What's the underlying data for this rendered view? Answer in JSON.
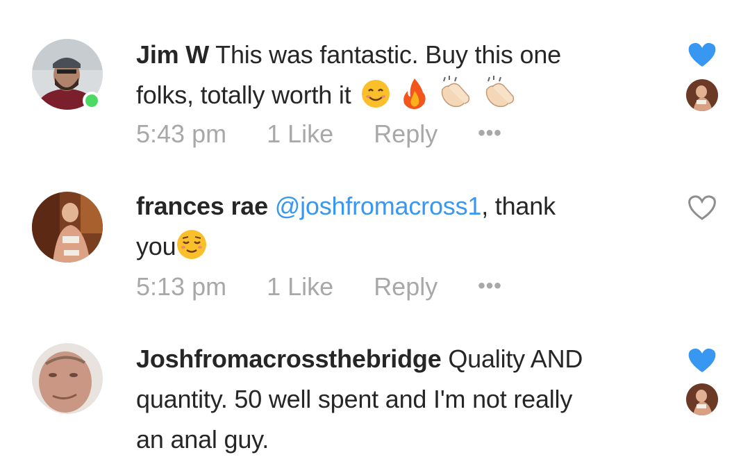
{
  "comments": [
    {
      "username": "Jim W",
      "text_line1": "This was fantastic. Buy this one",
      "text_line2": "folks, totally worth it",
      "emojis": [
        "smiling-face",
        "fire",
        "clapping-hands",
        "clapping-hands"
      ],
      "time": "5:43 pm",
      "likes": "1 Like",
      "reply": "Reply",
      "more": "•••",
      "liked": true,
      "online": true
    },
    {
      "username": "frances rae",
      "mention": "@joshfromacross1",
      "text_after_mention": ", thank",
      "text_line2": "you",
      "emojis": [
        "relieved-face"
      ],
      "time": "5:13 pm",
      "likes": "1 Like",
      "reply": "Reply",
      "more": "•••",
      "liked": false
    },
    {
      "username": "Joshfromacrossthebridge",
      "text_line1": "Quality AND",
      "text_line2": "quantity. 50 well spent and I'm not really",
      "text_line3": "an anal guy.",
      "liked": true
    }
  ],
  "colors": {
    "text": "#262626",
    "meta": "#a8a8a8",
    "mention": "#3897f0",
    "heart_filled": "#3897f0",
    "heart_outline": "#8e8e8e",
    "online": "#4cd964"
  }
}
